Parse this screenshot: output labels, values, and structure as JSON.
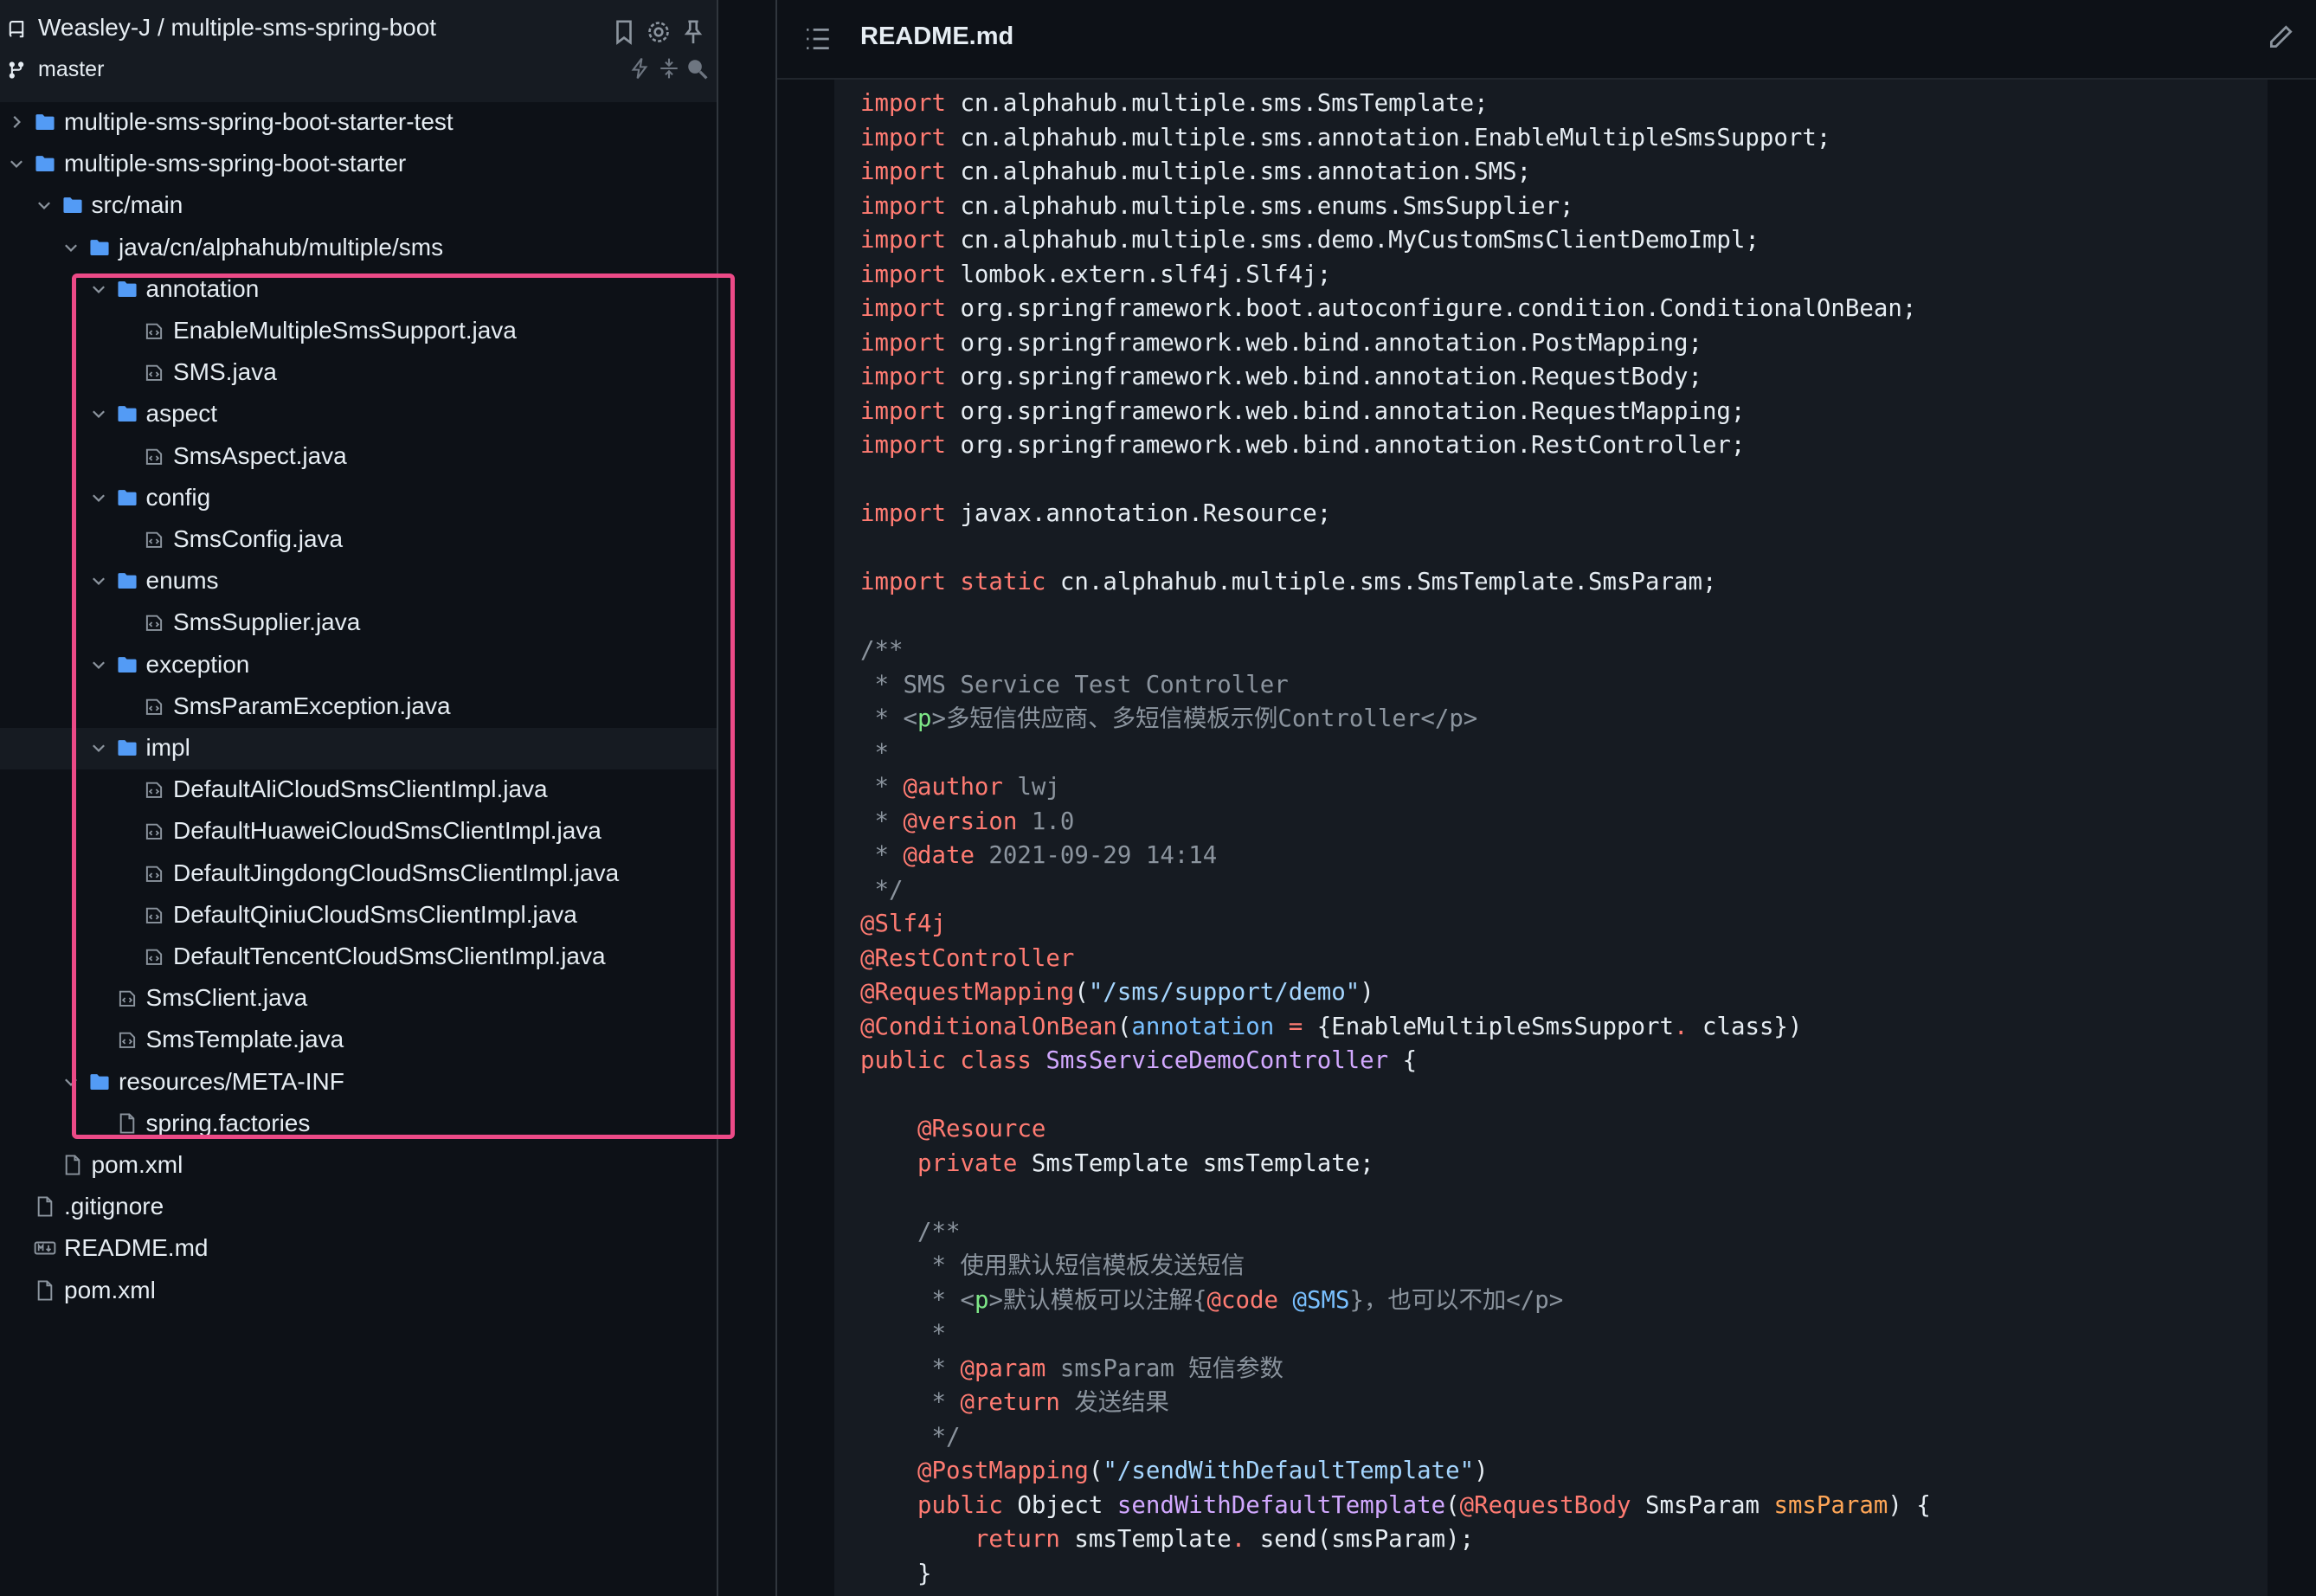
{
  "sidebar": {
    "repo_title": "Weasley-J / multiple-sms-spring-boot",
    "branch": "master",
    "tree": [
      {
        "label": "multiple-sms-spring-boot-starter-test",
        "type": "folder",
        "depth": 0,
        "expanded": false
      },
      {
        "label": "multiple-sms-spring-boot-starter",
        "type": "folder",
        "depth": 0,
        "expanded": true
      },
      {
        "label": "src/main",
        "type": "folder",
        "depth": 1,
        "expanded": true
      },
      {
        "label": "java/cn/alphahub/multiple/sms",
        "type": "folder",
        "depth": 2,
        "expanded": true
      },
      {
        "label": "annotation",
        "type": "folder",
        "depth": 3,
        "expanded": true
      },
      {
        "label": "EnableMultipleSmsSupport.java",
        "type": "java",
        "depth": 4
      },
      {
        "label": "SMS.java",
        "type": "java",
        "depth": 4
      },
      {
        "label": "aspect",
        "type": "folder",
        "depth": 3,
        "expanded": true
      },
      {
        "label": "SmsAspect.java",
        "type": "java",
        "depth": 4
      },
      {
        "label": "config",
        "type": "folder",
        "depth": 3,
        "expanded": true
      },
      {
        "label": "SmsConfig.java",
        "type": "java",
        "depth": 4
      },
      {
        "label": "enums",
        "type": "folder",
        "depth": 3,
        "expanded": true
      },
      {
        "label": "SmsSupplier.java",
        "type": "java",
        "depth": 4
      },
      {
        "label": "exception",
        "type": "folder",
        "depth": 3,
        "expanded": true
      },
      {
        "label": "SmsParamException.java",
        "type": "java",
        "depth": 4
      },
      {
        "label": "impl",
        "type": "folder",
        "depth": 3,
        "expanded": true,
        "selected": true
      },
      {
        "label": "DefaultAliCloudSmsClientImpl.java",
        "type": "java",
        "depth": 4
      },
      {
        "label": "DefaultHuaweiCloudSmsClientImpl.java",
        "type": "java",
        "depth": 4
      },
      {
        "label": "DefaultJingdongCloudSmsClientImpl.java",
        "type": "java",
        "depth": 4
      },
      {
        "label": "DefaultQiniuCloudSmsClientImpl.java",
        "type": "java",
        "depth": 4
      },
      {
        "label": "DefaultTencentCloudSmsClientImpl.java",
        "type": "java",
        "depth": 4
      },
      {
        "label": "SmsClient.java",
        "type": "java",
        "depth": 3
      },
      {
        "label": "SmsTemplate.java",
        "type": "java",
        "depth": 3
      },
      {
        "label": "resources/META-INF",
        "type": "folder",
        "depth": 2,
        "expanded": true
      },
      {
        "label": "spring.factories",
        "type": "file",
        "depth": 3
      },
      {
        "label": "pom.xml",
        "type": "file",
        "depth": 1
      },
      {
        "label": ".gitignore",
        "type": "file",
        "depth": 0
      },
      {
        "label": "README.md",
        "type": "markdown",
        "depth": 0
      },
      {
        "label": "pom.xml",
        "type": "file",
        "depth": 0
      }
    ]
  },
  "editor": {
    "title": "README.md",
    "code_lines": [
      [
        [
          "kw",
          "import"
        ],
        [
          "",
          "cn.alphahub.multiple.sms.SmsTemplate;"
        ]
      ],
      [
        [
          "kw",
          "import"
        ],
        [
          "",
          "cn.alphahub.multiple.sms.annotation.EnableMultipleSmsSupport;"
        ]
      ],
      [
        [
          "kw",
          "import"
        ],
        [
          "",
          "cn.alphahub.multiple.sms.annotation.SMS;"
        ]
      ],
      [
        [
          "kw",
          "import"
        ],
        [
          "",
          "cn.alphahub.multiple.sms.enums.SmsSupplier;"
        ]
      ],
      [
        [
          "kw",
          "import"
        ],
        [
          "",
          "cn.alphahub.multiple.sms.demo.MyCustomSmsClientDemoImpl;"
        ]
      ],
      [
        [
          "kw",
          "import"
        ],
        [
          "",
          "lombok.extern.slf4j.Slf4j;"
        ]
      ],
      [
        [
          "kw",
          "import"
        ],
        [
          "",
          "org.springframework.boot.autoconfigure.condition.ConditionalOnBean;"
        ]
      ],
      [
        [
          "kw",
          "import"
        ],
        [
          "",
          "org.springframework.web.bind.annotation.PostMapping;"
        ]
      ],
      [
        [
          "kw",
          "import"
        ],
        [
          "",
          "org.springframework.web.bind.annotation.RequestBody;"
        ]
      ],
      [
        [
          "kw",
          "import"
        ],
        [
          "",
          "org.springframework.web.bind.annotation.RequestMapping;"
        ]
      ],
      [
        [
          "kw",
          "import"
        ],
        [
          "",
          "org.springframework.web.bind.annotation.RestController;"
        ]
      ],
      [],
      [
        [
          "kw",
          "import"
        ],
        [
          "",
          "javax.annotation.Resource;"
        ]
      ],
      [],
      [
        [
          "kw",
          "import static"
        ],
        [
          "",
          "cn.alphahub.multiple.sms.SmsTemplate.SmsParam;"
        ]
      ],
      [],
      [
        [
          "cm",
          "/**"
        ]
      ],
      [
        [
          "cm",
          " * SMS Service Test Controller"
        ]
      ],
      [
        [
          "cm",
          " * <"
        ],
        [
          "tg",
          "p"
        ],
        [
          "cm",
          ">多短信供应商、多短信模板示例Controller</p>"
        ]
      ],
      [
        [
          "cm",
          " *"
        ]
      ],
      [
        [
          "cm",
          " * "
        ],
        [
          "an",
          "@author"
        ],
        [
          "cm",
          " lwj"
        ]
      ],
      [
        [
          "cm",
          " * "
        ],
        [
          "an",
          "@version"
        ],
        [
          "cm",
          " 1.0"
        ]
      ],
      [
        [
          "cm",
          " * "
        ],
        [
          "an",
          "@date"
        ],
        [
          "cm",
          " 2021-09-29 14:14"
        ]
      ],
      [
        [
          "cm",
          " */"
        ]
      ],
      [
        [
          "an",
          "@Slf4j"
        ]
      ],
      [
        [
          "an",
          "@RestController"
        ]
      ],
      [
        [
          "an",
          "@RequestMapping"
        ],
        [
          "",
          "("
        ],
        [
          "st",
          "\"/sms/support/demo\""
        ],
        [
          "",
          ")"
        ]
      ],
      [
        [
          "an",
          "@ConditionalOnBean"
        ],
        [
          "",
          "("
        ],
        [
          "vr",
          "annotation"
        ],
        [
          "",
          ""
        ],
        [
          "kw",
          " ="
        ],
        [
          "",
          " {EnableMultipleSmsSupport"
        ],
        [
          "kw",
          "."
        ],
        [
          "",
          "class})"
        ]
      ],
      [
        [
          "kw",
          "public class"
        ],
        [
          "cl",
          " SmsServiceDemoController"
        ],
        [
          "",
          " {"
        ]
      ],
      [],
      [
        [
          "",
          "    "
        ],
        [
          "an",
          "@Resource"
        ]
      ],
      [
        [
          "",
          "    "
        ],
        [
          "kw",
          "private"
        ],
        [
          "",
          " SmsTemplate smsTemplate;"
        ]
      ],
      [],
      [
        [
          "",
          "    "
        ],
        [
          "cm",
          "/**"
        ]
      ],
      [
        [
          "",
          "    "
        ],
        [
          "cm",
          " * 使用默认短信模板发送短信"
        ]
      ],
      [
        [
          "",
          "    "
        ],
        [
          "cm",
          " * <"
        ],
        [
          "tg",
          "p"
        ],
        [
          "cm",
          ">默认模板可以注解{"
        ],
        [
          "an",
          "@code"
        ],
        [
          "cm",
          " "
        ],
        [
          "vr",
          "@SMS"
        ],
        [
          "cm",
          "}，也可以不加</p>"
        ]
      ],
      [
        [
          "",
          "    "
        ],
        [
          "cm",
          " *"
        ]
      ],
      [
        [
          "",
          "    "
        ],
        [
          "cm",
          " * "
        ],
        [
          "an",
          "@param"
        ],
        [
          "cm",
          " smsParam 短信参数"
        ]
      ],
      [
        [
          "",
          "    "
        ],
        [
          "cm",
          " * "
        ],
        [
          "an",
          "@return"
        ],
        [
          "cm",
          " 发送结果"
        ]
      ],
      [
        [
          "",
          "    "
        ],
        [
          "cm",
          " */"
        ]
      ],
      [
        [
          "",
          "    "
        ],
        [
          "an",
          "@PostMapping"
        ],
        [
          "",
          "("
        ],
        [
          "st",
          "\"/sendWithDefaultTemplate\""
        ],
        [
          "",
          ")"
        ]
      ],
      [
        [
          "",
          "    "
        ],
        [
          "kw",
          "public"
        ],
        [
          "",
          " Object "
        ],
        [
          "cl",
          "sendWithDefaultTemplate"
        ],
        [
          "",
          "("
        ],
        [
          "an",
          "@RequestBody"
        ],
        [
          "",
          " SmsParam "
        ],
        [
          "pm",
          "smsParam"
        ],
        [
          "",
          ") {"
        ]
      ],
      [
        [
          "",
          "        "
        ],
        [
          "kw",
          "return"
        ],
        [
          "",
          " smsTemplate"
        ],
        [
          "kw",
          "."
        ],
        [
          "",
          "send(smsParam);"
        ]
      ],
      [
        [
          "",
          "    }"
        ]
      ]
    ]
  }
}
